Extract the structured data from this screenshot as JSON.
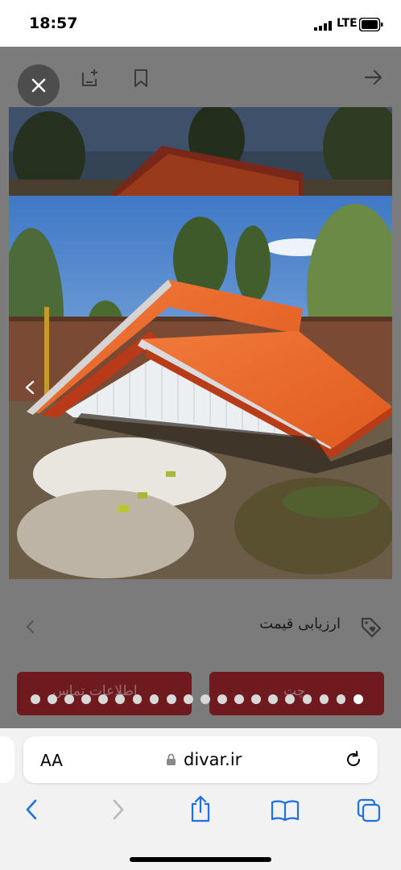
{
  "status_bar": {
    "time": "18:57",
    "network": "LTE"
  },
  "top_actions": {
    "close_icon": "close-icon",
    "add_note_icon": "add-note-icon",
    "bookmark_icon": "bookmark-icon",
    "forward_icon": "arrow-right-icon"
  },
  "gallery": {
    "current_index": 20,
    "total": 20,
    "prev_arrow": "chevron-left-icon"
  },
  "price_row": {
    "label": "ارزیابی قیمت",
    "icon": "price-tag-heart-icon"
  },
  "buttons": {
    "contact_label": "اطلاعات تماس",
    "chat_label": "چت"
  },
  "browser": {
    "aa_label": "AA",
    "url": "divar.ir",
    "toolbar_icons": [
      "back-icon",
      "forward-icon",
      "share-icon",
      "bookmarks-icon",
      "tabs-icon"
    ]
  },
  "colors": {
    "accent": "#a62626",
    "roof": "#e4642a"
  }
}
